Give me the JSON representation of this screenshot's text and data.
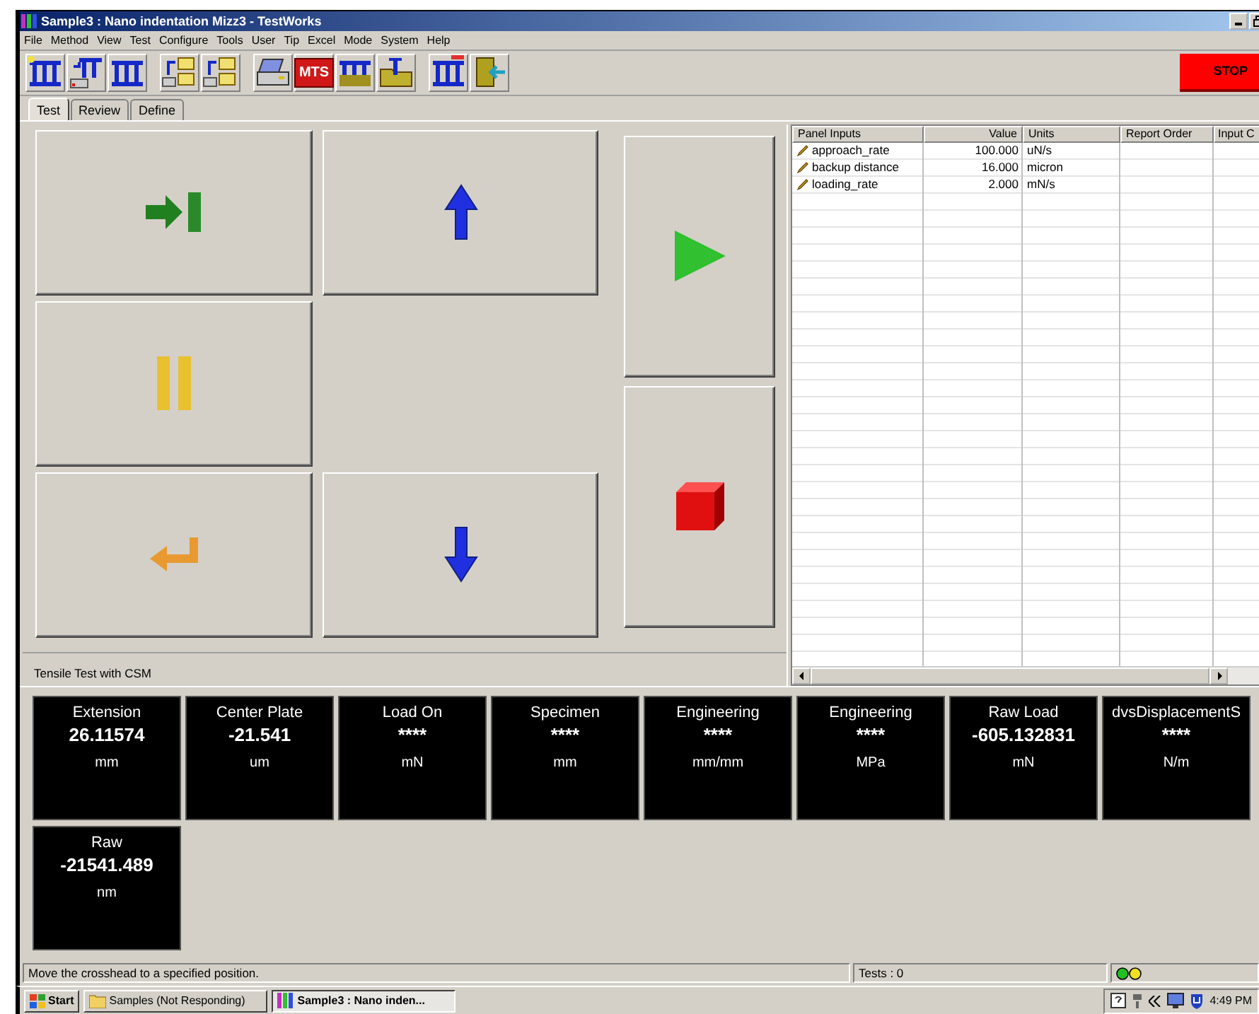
{
  "window": {
    "title": "Sample3 : Nano indentation Mizz3 - TestWorks"
  },
  "menu": [
    "File",
    "Method",
    "View",
    "Test",
    "Configure",
    "Tools",
    "User",
    "Tip",
    "Excel",
    "Mode",
    "System",
    "Help"
  ],
  "toolbar": {
    "logo": "MTS",
    "stop": "STOP"
  },
  "tabs": [
    {
      "label": "Test",
      "selected": true
    },
    {
      "label": "Review",
      "selected": false
    },
    {
      "label": "Define",
      "selected": false
    }
  ],
  "test_name": "Tensile Test with CSM",
  "table": {
    "columns": [
      "Panel Inputs",
      "Value",
      "Units",
      "Report Order",
      "Input C"
    ],
    "rows": [
      {
        "name": "approach_rate",
        "value": "100.000",
        "units": "uN/s"
      },
      {
        "name": "backup distance",
        "value": "16.000",
        "units": "micron"
      },
      {
        "name": "loading_rate",
        "value": "2.000",
        "units": "mN/s"
      }
    ]
  },
  "meters": [
    {
      "label": "Extension",
      "value": "26.11574",
      "unit": "mm"
    },
    {
      "label": "Center Plate",
      "value": "-21.541",
      "unit": "um"
    },
    {
      "label": "Load On",
      "value": "****",
      "unit": "mN"
    },
    {
      "label": "Specimen",
      "value": "****",
      "unit": "mm"
    },
    {
      "label": "Engineering",
      "value": "****",
      "unit": "mm/mm"
    },
    {
      "label": "Engineering",
      "value": "****",
      "unit": "MPa"
    },
    {
      "label": "Raw Load",
      "value": "-605.132831",
      "unit": "mN"
    },
    {
      "label": "dvsDisplacementS",
      "value": "****",
      "unit": "N/m"
    },
    {
      "label": "Raw",
      "value": "-21541.489",
      "unit": "nm"
    }
  ],
  "status_bar": {
    "message": "Move the crosshead to a specified position.",
    "tests": "Tests : 0"
  },
  "taskbar": {
    "start": "Start",
    "items": [
      {
        "label": "Samples (Not Responding)",
        "selected": false
      },
      {
        "label": "Sample3 : Nano inden...",
        "selected": true
      }
    ],
    "clock": "4:49 PM"
  }
}
